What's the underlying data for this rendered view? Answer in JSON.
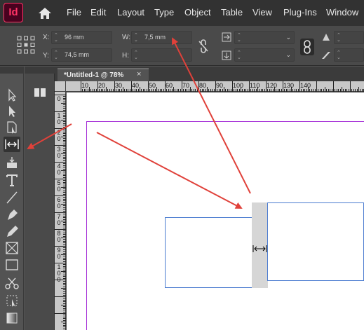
{
  "app": {
    "logo": "Id"
  },
  "menu": [
    "File",
    "Edit",
    "Layout",
    "Type",
    "Object",
    "Table",
    "View",
    "Plug-Ins",
    "Window"
  ],
  "control_panel": {
    "x": {
      "label": "X:",
      "value": "96 mm"
    },
    "y": {
      "label": "Y:",
      "value": "74,5 mm"
    },
    "w": {
      "label": "W:",
      "value": "7,5 mm"
    },
    "h": {
      "label": "H:",
      "value": ""
    }
  },
  "document_tab": {
    "title": "*Untitled-1 @ 78%",
    "close": "×"
  },
  "ruler_h": [
    "10",
    "20",
    "30",
    "40",
    "50",
    "60",
    "70",
    "80",
    "90",
    "100",
    "110",
    "120",
    "130",
    "140"
  ],
  "ruler_v": [
    "0",
    "1 0",
    "2 0",
    "3 0",
    "4 0",
    "5 0",
    "6 0",
    "7 0",
    "8 0",
    "9 0",
    "1 0 0"
  ],
  "icons": [
    "home-icon",
    "reference-point-icon",
    "link-broken-icon",
    "chain-link-icon",
    "selection-tool-icon",
    "direct-selection-tool-icon",
    "page-tool-icon",
    "gap-tool-icon",
    "content-collector-tool-icon",
    "type-tool-icon",
    "line-tool-icon",
    "pen-tool-icon",
    "pencil-tool-icon",
    "rectangle-frame-tool-icon",
    "rectangle-tool-icon",
    "scissors-tool-icon",
    "free-transform-tool-icon",
    "gradient-swatch-tool-icon",
    "pages-panel-icon"
  ],
  "colors": {
    "accent": "#ff3366",
    "arrow": "#e0413a",
    "margin": "#a42cd6",
    "frame": "#4a7bd0"
  }
}
